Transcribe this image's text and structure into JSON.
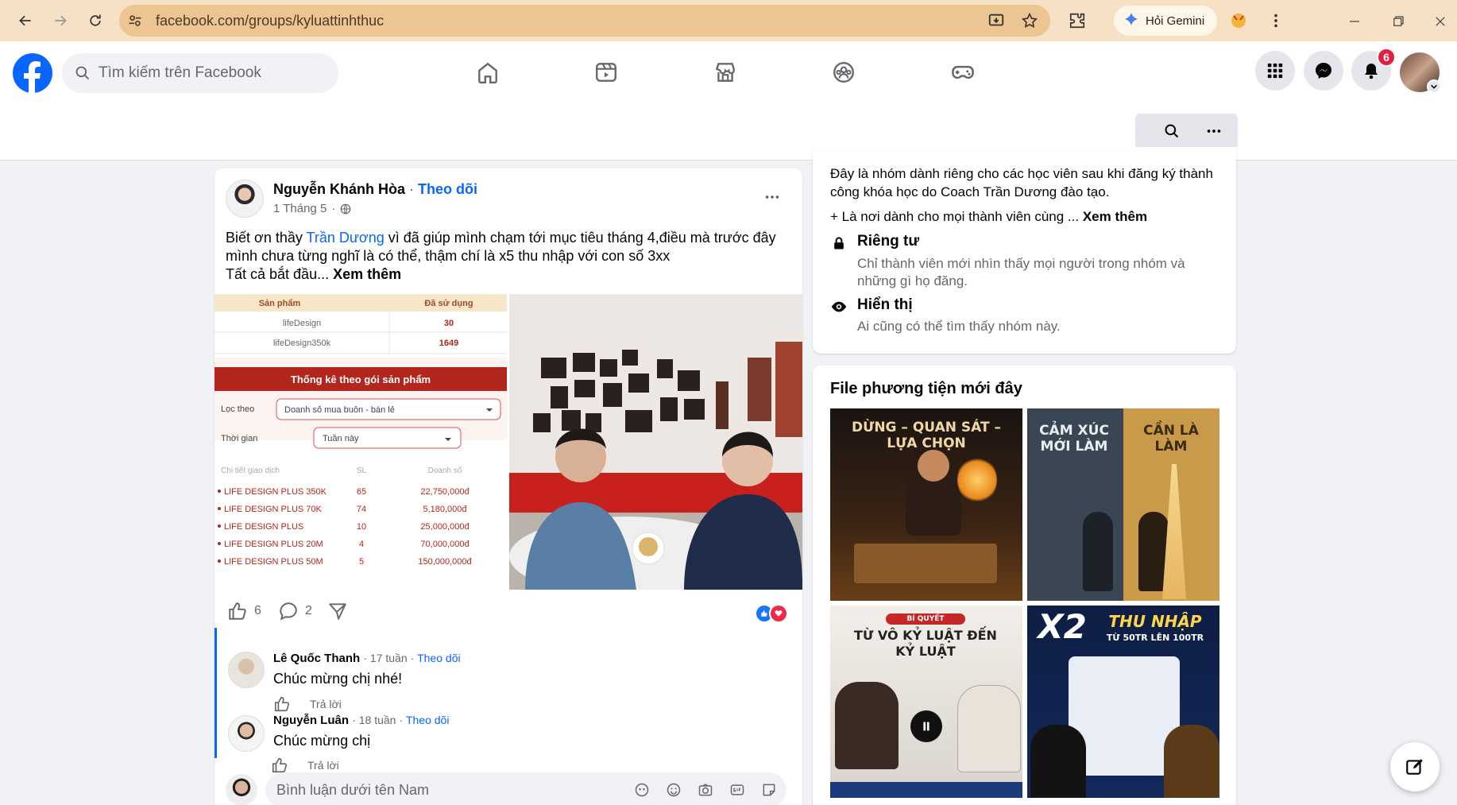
{
  "browser": {
    "url": "facebook.com/groups/kyluattinhthuc",
    "gemini_label": "Hỏi Gemini"
  },
  "header": {
    "search_placeholder": "Tìm kiếm trên Facebook",
    "notification_count": "6"
  },
  "post": {
    "author": "Nguyễn Khánh Hòa",
    "follow": "Theo dõi",
    "date": "1 Tháng 5",
    "separator": "·",
    "text_pre": "Biết ơn thầy ",
    "text_link": "Trần Dương",
    "text_post": " vì đã giúp mình chạm tới mục tiêu tháng 4,điều mà trước đây mình chưa từng nghĩ là có thể, thậm chí là x5 thu nhập với con số 3xx",
    "text_line2": "Tất cả bắt đầu...",
    "see_more": "Xem thêm",
    "like_count": "6",
    "comment_count": "2",
    "stat_image": {
      "col1": "Sản phẩm",
      "col2": "Đã sử dụng",
      "rows": [
        {
          "name": "lifeDesign",
          "used": "30"
        },
        {
          "name": "lifeDesign350k",
          "used": "1649"
        }
      ],
      "banner": "Thống kê theo gói sản phẩm",
      "filter_label": "Lọc theo",
      "filter_value": "Doanh số mua buôn - bán lẻ",
      "time_label": "Thời gian",
      "time_value": "Tuần này",
      "detail_h1": "Chi tiết giao dịch",
      "detail_h2": "SL",
      "detail_h3": "Doanh số",
      "details": [
        {
          "name": "LIFE DESIGN PLUS 350K",
          "qty": "65",
          "rev": "22,750,000đ"
        },
        {
          "name": "LIFE DESIGN PLUS 70K",
          "qty": "74",
          "rev": "5,180,000đ"
        },
        {
          "name": "LIFE DESIGN PLUS",
          "qty": "10",
          "rev": "25,000,000đ"
        },
        {
          "name": "LIFE DESIGN PLUS 20M",
          "qty": "4",
          "rev": "70,000,000đ"
        },
        {
          "name": "LIFE DESIGN PLUS 50M",
          "qty": "5",
          "rev": "150,000,000đ"
        }
      ]
    }
  },
  "comments": [
    {
      "name": "Lê Quốc Thanh",
      "time": "17 tuần",
      "follow": "Theo dõi",
      "text": "Chúc mừng chị nhé!",
      "reply": "Trả lời"
    },
    {
      "name": "Nguyễn Luân",
      "time": "18 tuần",
      "follow": "Theo dõi",
      "text": "Chúc mừng chị",
      "reply": "Trả lời"
    }
  ],
  "comment_input_placeholder": "Bình luận dưới tên Nam",
  "about": {
    "description": "Đây là nhóm dành riêng cho các học viên sau khi đăng ký thành công khóa học do Coach Trần Dương đào tạo.",
    "more_text": "+ Là nơi dành cho mọi thành viên cùng ...",
    "see_more": "Xem thêm",
    "private_title": "Riêng tư",
    "private_desc": "Chỉ thành viên mới nhìn thấy mọi người trong nhóm và những gì họ đăng.",
    "visible_title": "Hiển thị",
    "visible_desc": "Ai cũng có thể tìm thấy nhóm này."
  },
  "media": {
    "title": "File phương tiện mới đây",
    "tiles": [
      {
        "caption": "DỪNG – QUAN SÁT – LỰA CHỌN"
      },
      {
        "caption_left": "CẢM XÚC MỚI LÀM",
        "caption_right": "CẦN LÀ LÀM"
      },
      {
        "caption_small": "BÍ QUYẾT",
        "caption": "TỪ VÔ KỶ LUẬT ĐẾN KỶ LUẬT"
      },
      {
        "caption_big": "X2",
        "caption": "THU NHẬP",
        "caption_small": "TỪ 50TR LÊN 100TR"
      }
    ]
  },
  "colors": {
    "brand": "#0866ff",
    "chrome_bar": "#f7e1c5",
    "badge": "#e41e3f"
  }
}
